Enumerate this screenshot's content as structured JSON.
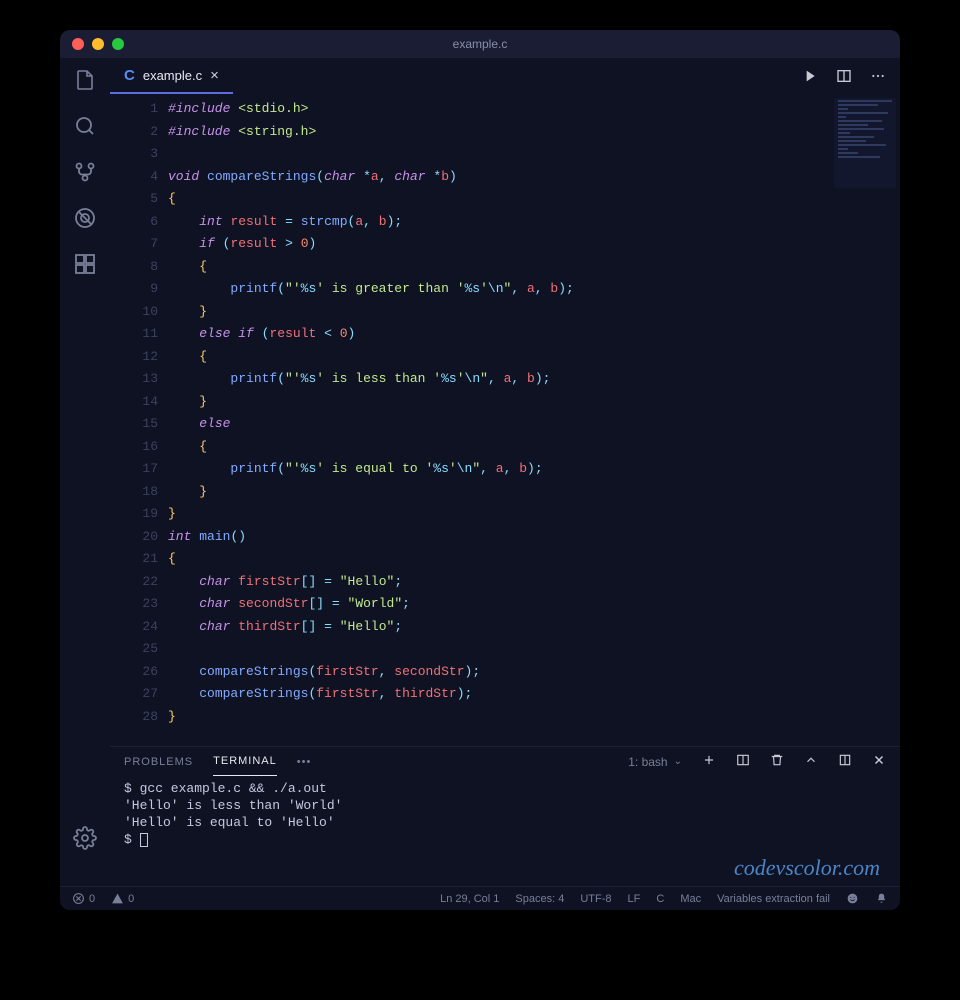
{
  "window": {
    "title": "example.c"
  },
  "tab": {
    "filename": "example.c",
    "lang_badge": "C"
  },
  "code": {
    "line_numbers": [
      "1",
      "2",
      "3",
      "4",
      "5",
      "6",
      "7",
      "8",
      "9",
      "10",
      "11",
      "12",
      "13",
      "14",
      "15",
      "16",
      "17",
      "18",
      "19",
      "20",
      "21",
      "22",
      "23",
      "24",
      "25",
      "26",
      "27",
      "28"
    ],
    "lines_html": [
      "<span class='kw'>#include</span> <span class='inc'>&lt;stdio.h&gt;</span>",
      "<span class='kw'>#include</span> <span class='inc'>&lt;string.h&gt;</span>",
      "",
      "<span class='ty'>void</span> <span class='fn'>compareStrings</span><span class='pn'>(</span><span class='ty'>char</span> <span class='op'>*</span><span class='id'>a</span><span class='pn'>,</span> <span class='ty'>char</span> <span class='op'>*</span><span class='id'>b</span><span class='pn'>)</span>",
      "<span class='br'>{</span>",
      "    <span class='ty'>int</span> <span class='id'>result</span> <span class='op'>=</span> <span class='fn'>strcmp</span><span class='pn'>(</span><span class='id'>a</span><span class='pn'>,</span> <span class='id'>b</span><span class='pn'>);</span>",
      "    <span class='kw'>if</span> <span class='pn'>(</span><span class='id'>result</span> <span class='op'>&gt;</span> <span class='num'>0</span><span class='pn'>)</span>",
      "    <span class='br'>{</span>",
      "        <span class='fn'>printf</span><span class='pn'>(</span><span class='str'>\"'<span class='esc'>%s</span>' is greater than '<span class='esc'>%s</span>'<span class='esc'>\\n</span>\"</span><span class='pn'>,</span> <span class='id'>a</span><span class='pn'>,</span> <span class='id'>b</span><span class='pn'>);</span>",
      "    <span class='br'>}</span>",
      "    <span class='kw'>else</span> <span class='kw'>if</span> <span class='pn'>(</span><span class='id'>result</span> <span class='op'>&lt;</span> <span class='num'>0</span><span class='pn'>)</span>",
      "    <span class='br'>{</span>",
      "        <span class='fn'>printf</span><span class='pn'>(</span><span class='str'>\"'<span class='esc'>%s</span>' is less than '<span class='esc'>%s</span>'<span class='esc'>\\n</span>\"</span><span class='pn'>,</span> <span class='id'>a</span><span class='pn'>,</span> <span class='id'>b</span><span class='pn'>);</span>",
      "    <span class='br'>}</span>",
      "    <span class='kw'>else</span>",
      "    <span class='br'>{</span>",
      "        <span class='fn'>printf</span><span class='pn'>(</span><span class='str'>\"'<span class='esc'>%s</span>' is equal to '<span class='esc'>%s</span>'<span class='esc'>\\n</span>\"</span><span class='pn'>,</span> <span class='id'>a</span><span class='pn'>,</span> <span class='id'>b</span><span class='pn'>);</span>",
      "    <span class='br'>}</span>",
      "<span class='br'>}</span>",
      "<span class='ty'>int</span> <span class='fn'>main</span><span class='pn'>()</span>",
      "<span class='br'>{</span>",
      "    <span class='ty'>char</span> <span class='id'>firstStr</span><span class='pn'>[]</span> <span class='op'>=</span> <span class='str'>\"Hello\"</span><span class='pn'>;</span>",
      "    <span class='ty'>char</span> <span class='id'>secondStr</span><span class='pn'>[]</span> <span class='op'>=</span> <span class='str'>\"World\"</span><span class='pn'>;</span>",
      "    <span class='ty'>char</span> <span class='id'>thirdStr</span><span class='pn'>[]</span> <span class='op'>=</span> <span class='str'>\"Hello\"</span><span class='pn'>;</span>",
      "",
      "    <span class='fn'>compareStrings</span><span class='pn'>(</span><span class='id'>firstStr</span><span class='pn'>,</span> <span class='id'>secondStr</span><span class='pn'>);</span>",
      "    <span class='fn'>compareStrings</span><span class='pn'>(</span><span class='id'>firstStr</span><span class='pn'>,</span> <span class='id'>thirdStr</span><span class='pn'>);</span>",
      "<span class='br'>}</span>"
    ]
  },
  "panel": {
    "tabs": {
      "problems": "PROBLEMS",
      "terminal": "TERMINAL"
    },
    "terminal_label": "1: bash",
    "output": "$ gcc example.c && ./a.out\n'Hello' is less than 'World'\n'Hello' is equal to 'Hello'\n$ "
  },
  "watermark": "codevscolor.com",
  "status": {
    "errors": "0",
    "warnings": "0",
    "cursor": "Ln 29, Col 1",
    "spaces": "Spaces: 4",
    "encoding": "UTF-8",
    "eol": "LF",
    "lang": "C",
    "platform": "Mac",
    "msg": "Variables extraction fail"
  }
}
